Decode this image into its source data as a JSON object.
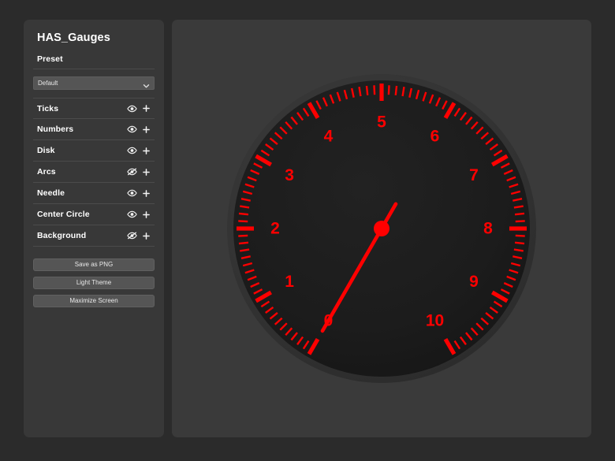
{
  "app": {
    "title": "HAS_Gauges",
    "accent_color": "#ff0000",
    "panel_color": "#383838",
    "stage_color": "#3a3a3a",
    "window_color": "#2b2b2b"
  },
  "sidebar": {
    "preset_label": "Preset",
    "preset_value": "Default",
    "preset_options": [
      "Default"
    ],
    "layers": [
      {
        "name": "Ticks",
        "visible": true,
        "visibility_icon": "eye-icon",
        "add_icon": "plus-icon"
      },
      {
        "name": "Numbers",
        "visible": true,
        "visibility_icon": "eye-icon",
        "add_icon": "plus-icon"
      },
      {
        "name": "Disk",
        "visible": true,
        "visibility_icon": "eye-icon",
        "add_icon": "plus-icon"
      },
      {
        "name": "Arcs",
        "visible": false,
        "visibility_icon": "eye-slash-icon",
        "add_icon": "plus-icon"
      },
      {
        "name": "Needle",
        "visible": true,
        "visibility_icon": "eye-icon",
        "add_icon": "plus-icon"
      },
      {
        "name": "Center Circle",
        "visible": true,
        "visibility_icon": "eye-icon",
        "add_icon": "plus-icon"
      },
      {
        "name": "Background",
        "visible": false,
        "visibility_icon": "eye-slash-icon",
        "add_icon": "plus-icon"
      }
    ],
    "buttons": [
      {
        "label": "Save as PNG"
      },
      {
        "label": "Light Theme"
      },
      {
        "label": "Maximize Screen"
      }
    ]
  },
  "chart_data": {
    "type": "gauge",
    "title": "",
    "min": 0,
    "max": 10,
    "value": 0,
    "major_tick_values": [
      0,
      1,
      2,
      3,
      4,
      5,
      6,
      7,
      8,
      9,
      10
    ],
    "number_labels": [
      "0",
      "1",
      "2",
      "3",
      "4",
      "5",
      "6",
      "7",
      "8",
      "9",
      "10"
    ],
    "minor_ticks_per_major": 10,
    "start_angle_deg": 120,
    "sweep_deg": 300,
    "tick_color": "#ff0000",
    "number_color": "#ff0000",
    "needle_color": "#ff0000",
    "center_circle_color": "#ff0000",
    "dial_face_color": "#1b1b1b",
    "bezel_color": "#2f2f2f",
    "arcs_visible": false,
    "background_visible": false
  }
}
